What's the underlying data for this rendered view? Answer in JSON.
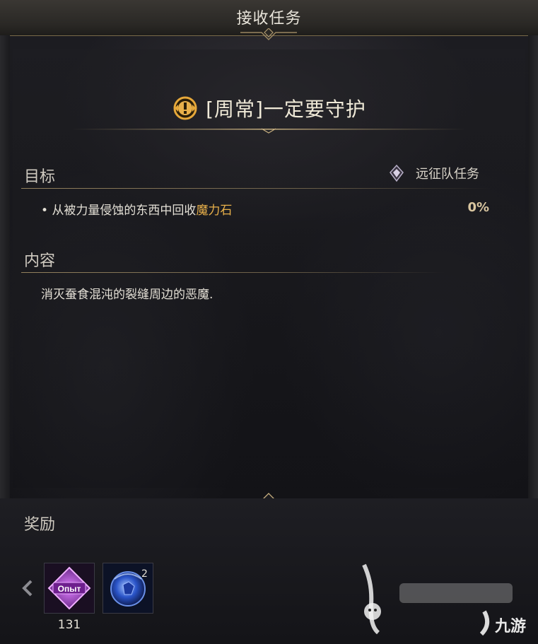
{
  "window": {
    "title": "接收任务"
  },
  "quest": {
    "title": "[周常]一定要守护",
    "icon": "exclamation-badge-icon"
  },
  "objective_section": {
    "label": "目标",
    "type_icon": "expedition-emblem-icon",
    "type_label": "远征队任务",
    "bullet": "•",
    "text_before": "从被力量侵蚀的东西中回收",
    "text_highlight": "魔力石",
    "progress": "0%"
  },
  "content_section": {
    "label": "内容",
    "text": "消灭蚕食混沌的裂缝周边的恶魔."
  },
  "rewards": {
    "label": "奖励",
    "items": [
      {
        "icon": "exp-crystal-icon",
        "label": "Опыт",
        "count": "131"
      },
      {
        "icon": "blue-orb-icon",
        "count": "2"
      }
    ]
  },
  "watermark": {
    "text": "九游",
    "logo": "rabbit-logo"
  },
  "colors": {
    "highlight": "#e8b04a",
    "accent_gold": "#a08c64"
  }
}
